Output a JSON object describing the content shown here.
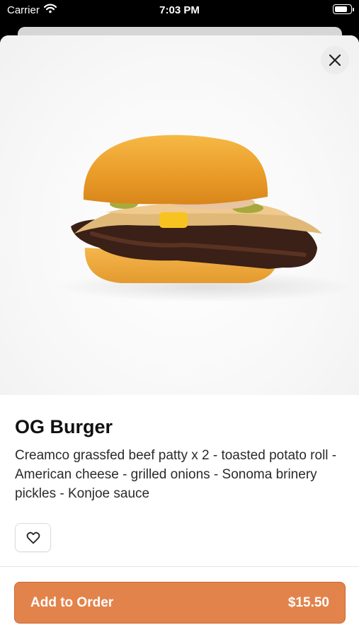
{
  "status_bar": {
    "carrier": "Carrier",
    "time": "7:03 PM",
    "battery_level": 0.85
  },
  "item": {
    "title": "OG Burger",
    "description": "Creamco grassfed beef patty x 2 - toasted potato roll - American cheese - grilled onions - Sonoma brinery pickles - Konjoe sauce",
    "image_icon": "burger-photo"
  },
  "actions": {
    "close_icon": "close-icon",
    "favorite_icon": "heart-outline-icon",
    "add_label": "Add to Order",
    "price": "$15.50"
  },
  "colors": {
    "accent": "#e3834c",
    "text": "#111111"
  }
}
